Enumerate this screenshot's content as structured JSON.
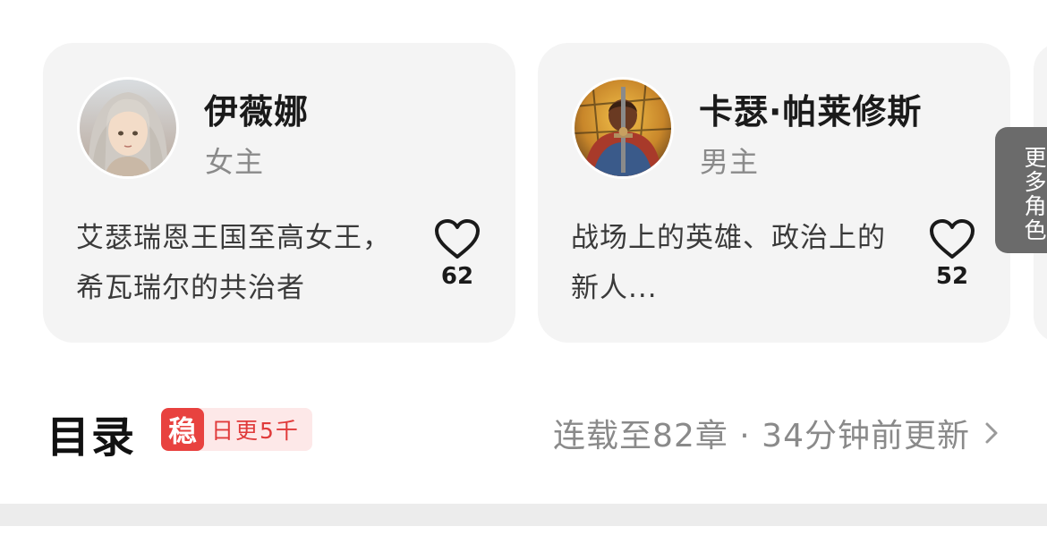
{
  "characters": [
    {
      "name": "伊薇娜",
      "role": "女主",
      "description": "艾瑟瑞恩王国至高女王，希瓦瑞尔的共治者",
      "likes": "62"
    },
    {
      "name": "卡瑟·帕莱修斯",
      "role": "男主",
      "description": "战场上的英雄、政治上的新人...",
      "likes": "52"
    }
  ],
  "more_roles_label": "更多角色",
  "catalog": {
    "title": "目录",
    "badge_stamp": "稳",
    "badge_text": "日更5千",
    "update_info": "连载至82章 · 34分钟前更新"
  },
  "colors": {
    "card_bg": "#f4f4f4",
    "badge_red": "#e8423f",
    "badge_bg": "#fde8e8",
    "muted_text": "#8a8a8a"
  }
}
